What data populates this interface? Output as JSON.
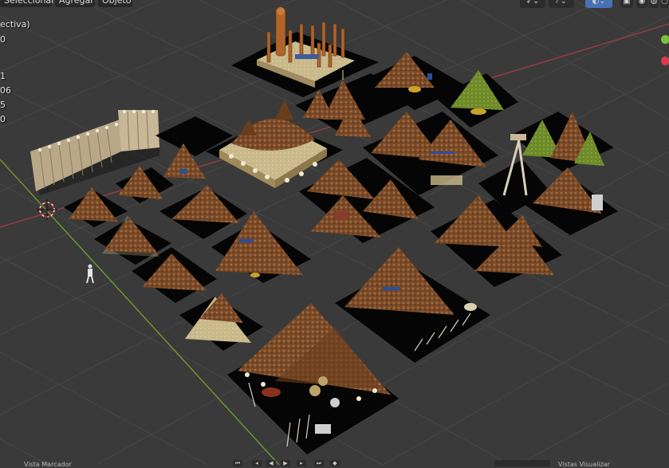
{
  "header": {
    "menu": [
      {
        "label": "Seleccionar"
      },
      {
        "label": "Agregar"
      },
      {
        "label": "Objeto"
      }
    ]
  },
  "overlay": {
    "lines": [
      "ectiva)",
      "0",
      "",
      "1",
      "06",
      "5",
      "0"
    ]
  },
  "footer": {
    "left_label": "Vista  Marcador",
    "right_label": "Vistas  Visualizar"
  },
  "colors": {
    "viewport_bg": "#3a3a3a",
    "grid": "#444444",
    "x_axis": "#9a3a45",
    "y_axis": "#6e9a2e",
    "gizmo_green": "#7bbf3a",
    "gizmo_red": "#e0374a",
    "header_bg": "#282828",
    "active_blue": "#4772b3"
  },
  "icons": [
    "cursor-icon",
    "transform-icon",
    "overlay-icon",
    "shading-icon",
    "solid-shading-icon",
    "material-shading-icon",
    "render-shading-icon"
  ]
}
